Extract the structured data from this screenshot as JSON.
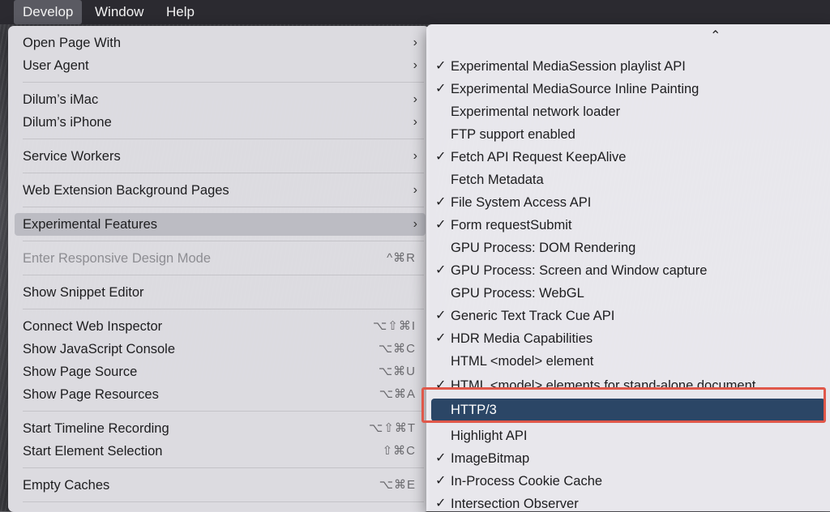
{
  "menubar": {
    "items": [
      "Develop",
      "Window",
      "Help"
    ]
  },
  "develop_menu": {
    "items": [
      {
        "label": "Open Page With",
        "arrow": "›"
      },
      {
        "label": "User Agent",
        "arrow": "›"
      },
      {
        "label": "Dilum’s iMac",
        "arrow": "›"
      },
      {
        "label": "Dilum’s iPhone",
        "arrow": "›"
      },
      {
        "label": "Service Workers",
        "arrow": "›"
      },
      {
        "label": "Web Extension Background Pages",
        "arrow": "›"
      },
      {
        "label": "Experimental Features",
        "arrow": "›"
      },
      {
        "label": "Enter Responsive Design Mode",
        "shortcut": "^⌘R"
      },
      {
        "label": "Show Snippet Editor"
      },
      {
        "label": "Connect Web Inspector",
        "shortcut": "⌥⇧⌘I"
      },
      {
        "label": "Show JavaScript Console",
        "shortcut": "⌥⌘C"
      },
      {
        "label": "Show Page Source",
        "shortcut": "⌥⌘U"
      },
      {
        "label": "Show Page Resources",
        "shortcut": "⌥⌘A"
      },
      {
        "label": "Start Timeline Recording",
        "shortcut": "⌥⇧⌘T"
      },
      {
        "label": "Start Element Selection",
        "shortcut": "⇧⌘C"
      },
      {
        "label": "Empty Caches",
        "shortcut": "⌥⌘E"
      }
    ]
  },
  "experimental_features": {
    "scroll_up": "⌃",
    "check_mark": "✓",
    "items": [
      {
        "label": "Experimental MediaSession playlist API",
        "checked": true
      },
      {
        "label": "Experimental MediaSource Inline Painting",
        "checked": true
      },
      {
        "label": "Experimental network loader",
        "checked": false
      },
      {
        "label": "FTP support enabled",
        "checked": false
      },
      {
        "label": "Fetch API Request KeepAlive",
        "checked": true
      },
      {
        "label": "Fetch Metadata",
        "checked": false
      },
      {
        "label": "File System Access API",
        "checked": true
      },
      {
        "label": "Form requestSubmit",
        "checked": true
      },
      {
        "label": "GPU Process: DOM Rendering",
        "checked": false
      },
      {
        "label": "GPU Process: Screen and Window capture",
        "checked": true
      },
      {
        "label": "GPU Process: WebGL",
        "checked": false
      },
      {
        "label": "Generic Text Track Cue API",
        "checked": true
      },
      {
        "label": "HDR Media Capabilities",
        "checked": true
      },
      {
        "label": "HTML <model> element",
        "checked": false
      },
      {
        "label": "HTML <model> elements for stand-alone document",
        "checked": true
      },
      {
        "label": "HTTP/3",
        "checked": false
      },
      {
        "label": "Highlight API",
        "checked": false
      },
      {
        "label": "ImageBitmap",
        "checked": true
      },
      {
        "label": "In-Process Cookie Cache",
        "checked": true
      },
      {
        "label": "Intersection Observer",
        "checked": true
      }
    ]
  }
}
